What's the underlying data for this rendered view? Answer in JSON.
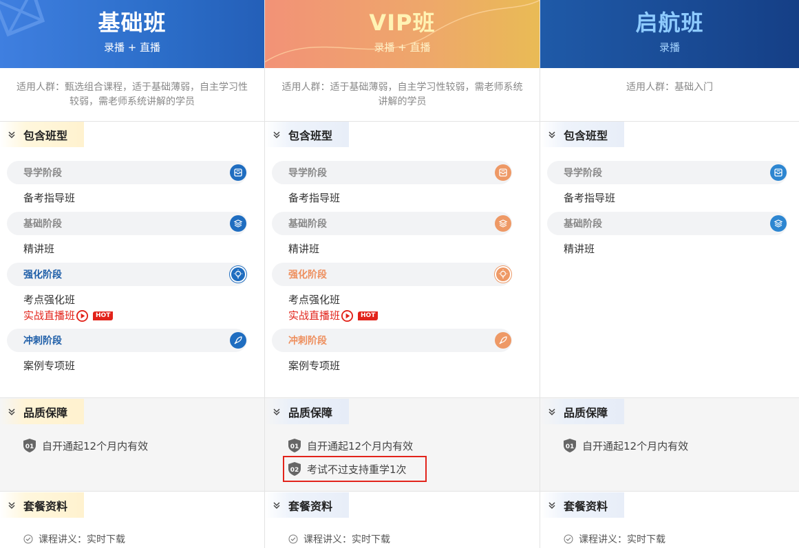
{
  "columns": [
    {
      "title": "基础班",
      "subtitle": "录播 + 直播",
      "audience": "适用人群：甄选组合课程，适于基础薄弱，自主学习性较弱，需老师系统讲解的学员",
      "include_title": "包含班型",
      "stages": [
        {
          "name": "导学阶段",
          "icon": "book-icon",
          "classes": [
            "备考指导班"
          ]
        },
        {
          "name": "基础阶段",
          "icon": "layers-icon",
          "classes": [
            "精讲班"
          ]
        },
        {
          "name": "强化阶段",
          "icon": "bulb-icon",
          "classes": [
            "考点强化班"
          ],
          "live": "实战直播班",
          "hot": "HOT"
        },
        {
          "name": "冲刺阶段",
          "icon": "rocket-icon",
          "classes": [
            "案例专项班"
          ]
        }
      ],
      "quality_title": "品质保障",
      "quality": [
        {
          "num": "01",
          "text": "自开通起12个月内有效"
        }
      ],
      "package_title": "套餐资料",
      "package_item": "课程讲义：实时下载"
    },
    {
      "title": "VIP班",
      "subtitle": "录播 + 直播",
      "audience": "适用人群：适于基础薄弱，自主学习性较弱，需老师系统讲解的学员",
      "include_title": "包含班型",
      "stages": [
        {
          "name": "导学阶段",
          "icon": "book-icon",
          "classes": [
            "备考指导班"
          ]
        },
        {
          "name": "基础阶段",
          "icon": "layers-icon",
          "classes": [
            "精讲班"
          ]
        },
        {
          "name": "强化阶段",
          "icon": "bulb-icon",
          "classes": [
            "考点强化班"
          ],
          "live": "实战直播班",
          "hot": "HOT"
        },
        {
          "name": "冲刺阶段",
          "icon": "rocket-icon",
          "classes": [
            "案例专项班"
          ]
        }
      ],
      "quality_title": "品质保障",
      "quality": [
        {
          "num": "01",
          "text": "自开通起12个月内有效"
        },
        {
          "num": "02",
          "text": "考试不过支持重学1次"
        }
      ],
      "package_title": "套餐资料",
      "package_item": "课程讲义：实时下载"
    },
    {
      "title": "启航班",
      "subtitle": "录播",
      "audience": "适用人群：基础入门",
      "include_title": "包含班型",
      "stages": [
        {
          "name": "导学阶段",
          "icon": "book-icon",
          "classes": [
            "备考指导班"
          ]
        },
        {
          "name": "基础阶段",
          "icon": "layers-icon",
          "classes": [
            "精讲班"
          ]
        }
      ],
      "quality_title": "品质保障",
      "quality": [
        {
          "num": "01",
          "text": "自开通起12个月内有效"
        }
      ],
      "package_title": "套餐资料",
      "package_item": "课程讲义：实时下载"
    }
  ],
  "colors": {
    "basic_header": "#2c6ec9",
    "vip_header": "#eea86a",
    "starter_header": "#153f86",
    "live_red": "#e2231a",
    "stage_active_blue": "#1e5ea8",
    "stage_active_orange": "#ee8f5e"
  }
}
